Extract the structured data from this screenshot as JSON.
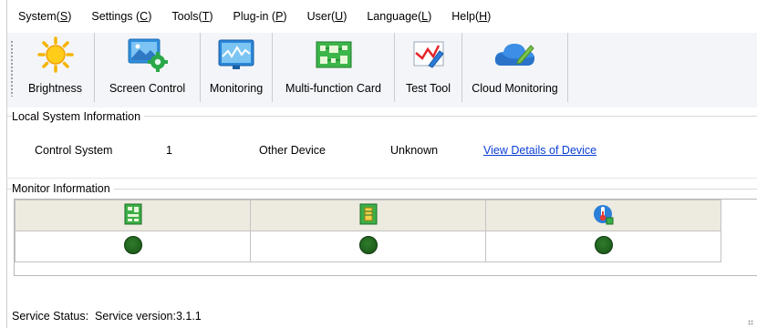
{
  "menubar": {
    "items": [
      {
        "label": "System(",
        "acc": "S",
        "tail": ")"
      },
      {
        "label": "Settings (",
        "acc": "C",
        "tail": ")"
      },
      {
        "label": "Tools(",
        "acc": "T",
        "tail": ")"
      },
      {
        "label": "Plug-in (",
        "acc": "P",
        "tail": ")"
      },
      {
        "label": "User(",
        "acc": "U",
        "tail": ")"
      },
      {
        "label": "Language(",
        "acc": "L",
        "tail": ")"
      },
      {
        "label": "Help(",
        "acc": "H",
        "tail": ")"
      }
    ]
  },
  "toolbar": {
    "items": [
      {
        "label": "Brightness",
        "icon": "sun-icon"
      },
      {
        "label": "Screen Control",
        "icon": "screen-control-icon"
      },
      {
        "label": "Monitoring",
        "icon": "monitoring-icon"
      },
      {
        "label": "Multi-function Card",
        "icon": "circuit-card-icon"
      },
      {
        "label": "Test Tool",
        "icon": "test-tool-icon"
      },
      {
        "label": "Cloud Monitoring",
        "icon": "cloud-icon"
      }
    ]
  },
  "local_system": {
    "title": "Local System Information",
    "control_system_label": "Control System",
    "control_system_value": "1",
    "other_device_label": "Other Device",
    "other_device_value": "Unknown",
    "details_link": "View Details of Device"
  },
  "monitor": {
    "title": "Monitor Information",
    "columns": [
      {
        "icon": "receiving-card-icon",
        "status": "normal"
      },
      {
        "icon": "sending-card-icon",
        "status": "normal"
      },
      {
        "icon": "temperature-icon",
        "status": "normal"
      }
    ],
    "status_color": "#2a7427"
  },
  "status_bar": {
    "label": "Service Status:",
    "value": "Service version:3.1.1"
  }
}
